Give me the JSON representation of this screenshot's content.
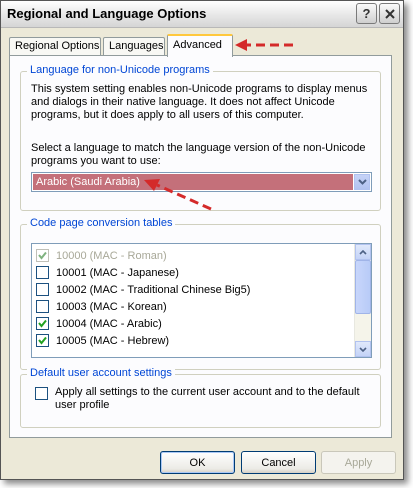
{
  "window": {
    "title": "Regional and Language Options"
  },
  "tabs": [
    {
      "label": "Regional Options"
    },
    {
      "label": "Languages"
    },
    {
      "label": "Advanced"
    }
  ],
  "non_unicode_group": {
    "title": "Language for non-Unicode programs",
    "description_lines": [
      "This system setting enables non-Unicode programs to display menus",
      "and dialogs in their native language. It does not affect Unicode",
      "programs, but it does apply to all users of this computer."
    ],
    "prompt_lines": [
      "Select a language to match the language version of the non-Unicode",
      "programs you want to use:"
    ],
    "selected_language": "Arabic (Saudi Arabia)"
  },
  "code_page_group": {
    "title": "Code page conversion tables",
    "items": [
      {
        "label": "10000 (MAC - Roman)",
        "checked": true,
        "disabled": true
      },
      {
        "label": "10001 (MAC - Japanese)",
        "checked": false,
        "disabled": false
      },
      {
        "label": "10002 (MAC - Traditional Chinese Big5)",
        "checked": false,
        "disabled": false
      },
      {
        "label": "10003 (MAC - Korean)",
        "checked": false,
        "disabled": false
      },
      {
        "label": "10004 (MAC - Arabic)",
        "checked": true,
        "disabled": false
      },
      {
        "label": "10005 (MAC - Hebrew)",
        "checked": true,
        "disabled": false
      }
    ]
  },
  "default_user_group": {
    "title": "Default user account settings",
    "checkbox_label_lines": [
      "Apply all settings to the current user account and to the default",
      "user profile"
    ],
    "checked": false
  },
  "buttons": {
    "ok": "OK",
    "cancel": "Cancel",
    "apply": "Apply"
  },
  "colors": {
    "selection_highlight": "#c4707a",
    "annotation_arrow": "#d42a2a",
    "group_title": "#0046d5",
    "active_tab_accent": "#ffc83c"
  },
  "icons": {
    "help": "question-mark-icon",
    "close": "close-x-icon",
    "dropdown": "chevron-down-icon",
    "scroll_up": "scroll-up-arrow-icon",
    "scroll_down": "scroll-down-arrow-icon",
    "check": "checkmark-icon"
  }
}
